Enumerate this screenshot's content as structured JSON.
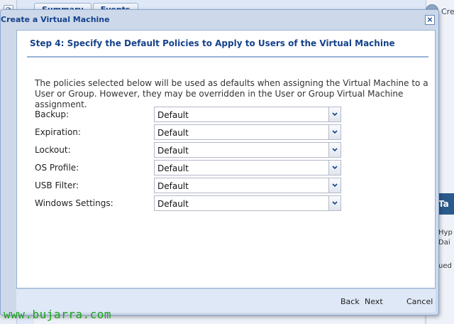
{
  "background": {
    "tabs": [
      "Summary",
      "Events"
    ],
    "right_labels": [
      "Cre",
      "Ta",
      "Hyp",
      "Dai",
      "ued"
    ]
  },
  "dialog": {
    "title": "Create a Virtual Machine",
    "step_title": "Step 4: Specify the Default Policies to Apply to Users of the Virtual Machine",
    "intro": "The policies selected below will be used as defaults when assigning the Virtual Machine to a User or Group. However, they may be overridden in the User or Group Virtual Machine assignment.",
    "fields": [
      {
        "label": "Backup:",
        "value": "Default"
      },
      {
        "label": "Expiration:",
        "value": "Default"
      },
      {
        "label": "Lockout:",
        "value": "Default"
      },
      {
        "label": "OS Profile:",
        "value": "Default"
      },
      {
        "label": "USB Filter:",
        "value": "Default"
      },
      {
        "label": "Windows Settings:",
        "value": "Default"
      }
    ],
    "buttons": {
      "back": "Back",
      "next": "Next",
      "cancel": "Cancel"
    }
  },
  "watermark": "www.bujarra.com",
  "colors": {
    "accent": "#15428b",
    "watermark": "#19a319",
    "frame": "#cdd9ea"
  }
}
